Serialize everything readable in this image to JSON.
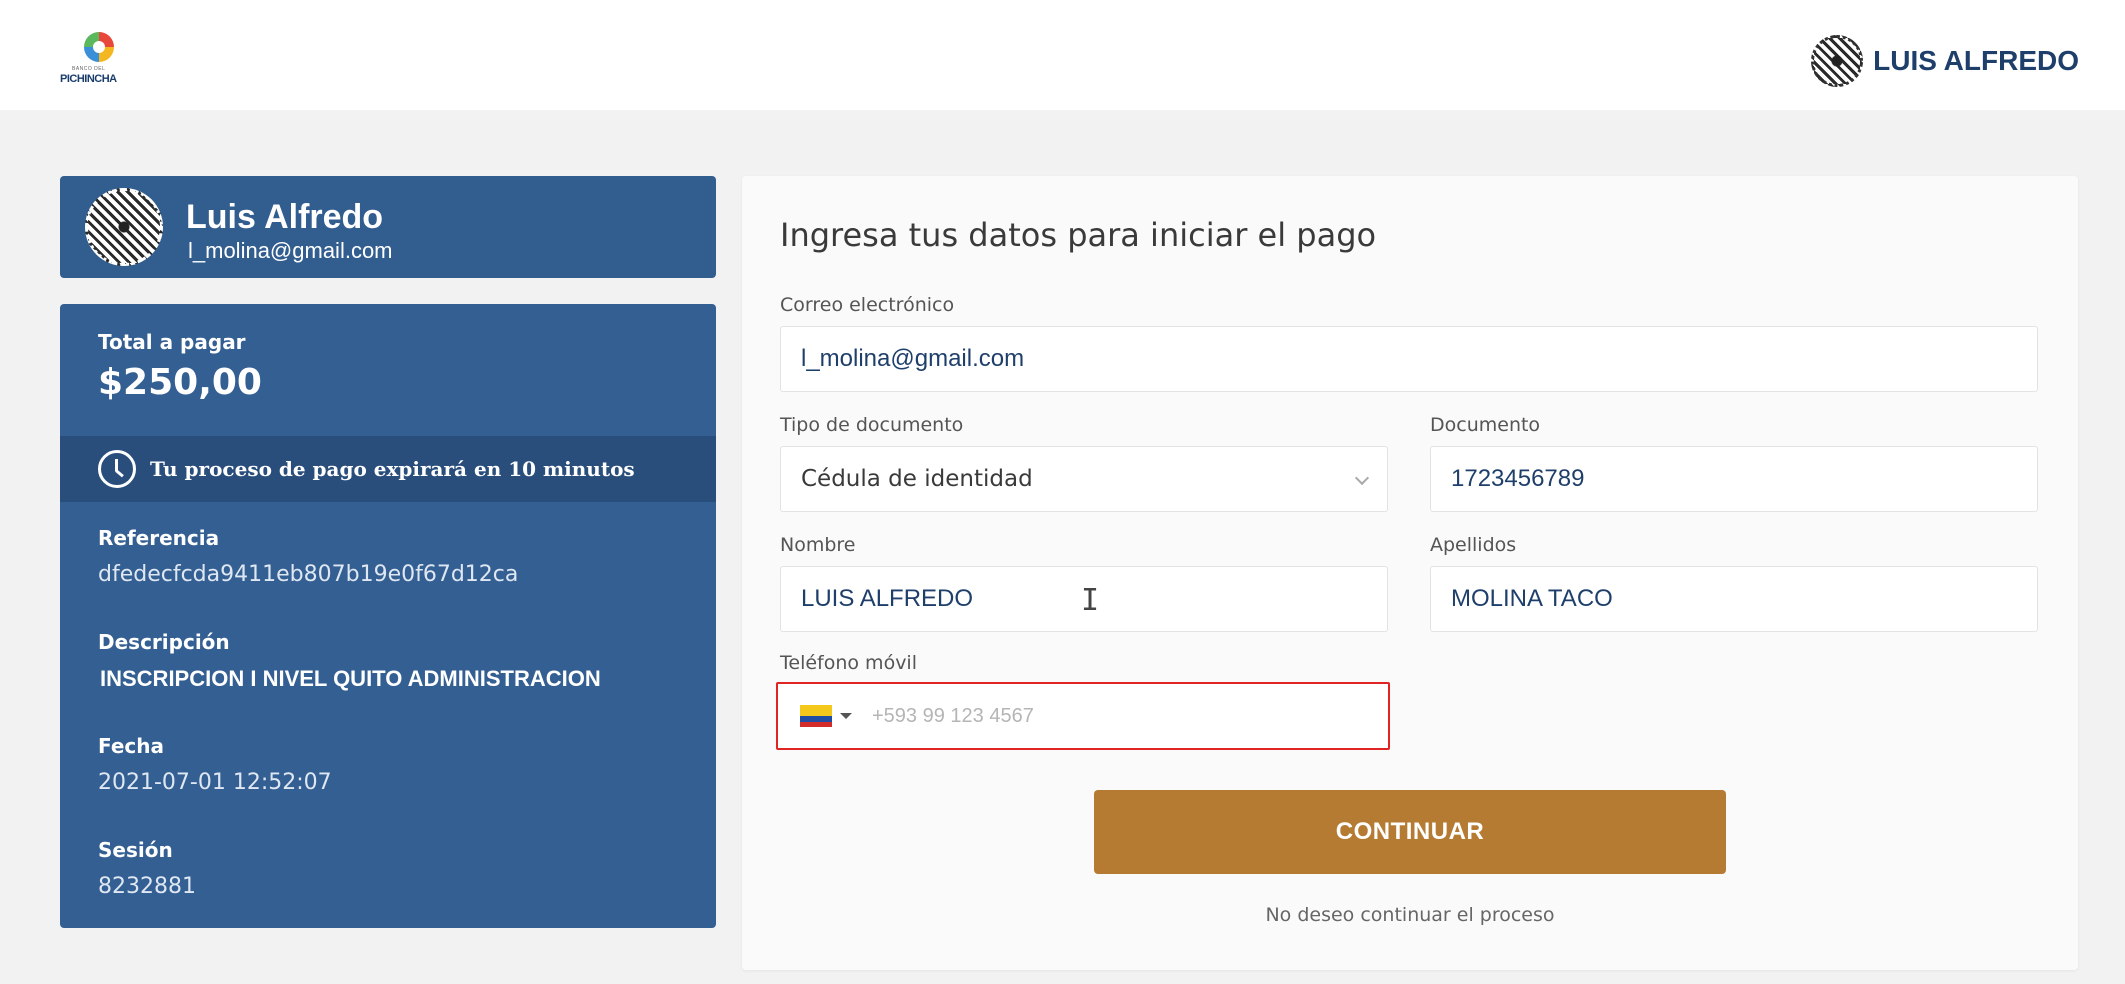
{
  "header": {
    "logo_text": "PICHINCHA",
    "logo_subtext": "BANCO DEL",
    "user_name": "LUIS ALFREDO",
    "icons": {
      "logo": "bank-logo-icon",
      "avatar": "user-avatar-icon"
    }
  },
  "profile": {
    "name": "Luis Alfredo",
    "email": "l_molina@gmail.com"
  },
  "summary": {
    "total_label": "Total a pagar",
    "total_amount": "$250,00",
    "timer_text": "Tu proceso de pago expirará en 10 minutos",
    "reference_label": "Referencia",
    "reference_value": "dfedecfcda9411eb807b19e0f67d12ca",
    "description_label": "Descripción",
    "description_value": "INSCRIPCION I NIVEL QUITO ADMINISTRACION",
    "date_label": "Fecha",
    "date_value": "2021-07-01 12:52:07",
    "session_label": "Sesión",
    "session_value": "8232881"
  },
  "form": {
    "title": "Ingresa tus datos para iniciar el pago",
    "email_label": "Correo electrónico",
    "email_value": "l_molina@gmail.com",
    "doc_type_label": "Tipo de documento",
    "doc_type_value": "Cédula de identidad",
    "document_label": "Documento",
    "document_value": "1723456789",
    "first_name_label": "Nombre",
    "first_name_value": "LUIS ALFREDO",
    "last_name_label": "Apellidos",
    "last_name_value": "MOLINA TACO",
    "phone_label": "Teléfono móvil",
    "phone_placeholder": "+593 99 123 4567",
    "continue_label": "CONTINUAR",
    "cancel_label": "No deseo continuar el proceso"
  },
  "colors": {
    "primary_blue": "#335f92",
    "accent_gold": "#b67b33",
    "error_red": "#e02424"
  }
}
